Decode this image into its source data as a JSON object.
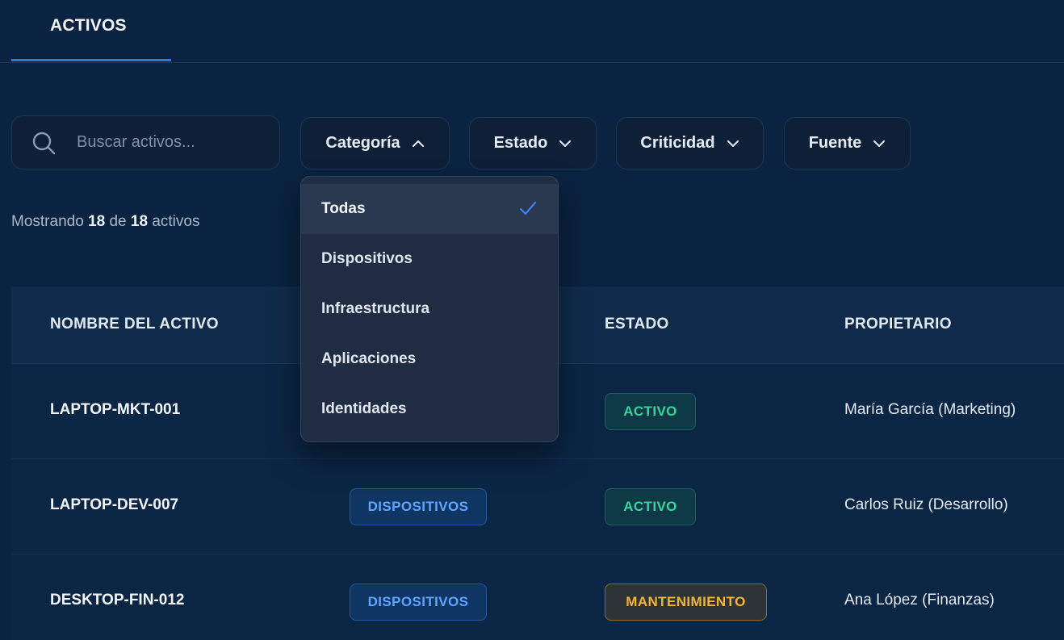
{
  "tabs": [
    {
      "label": "ACTIVOS"
    }
  ],
  "search": {
    "placeholder": "Buscar activos...",
    "value": ""
  },
  "filters": [
    {
      "label": "Categoría",
      "expanded": true
    },
    {
      "label": "Estado",
      "expanded": false
    },
    {
      "label": "Criticidad",
      "expanded": false
    },
    {
      "label": "Fuente",
      "expanded": false
    }
  ],
  "dropdown": {
    "options": [
      "Todas",
      "Dispositivos",
      "Infraestructura",
      "Aplicaciones",
      "Identidades"
    ],
    "selected": "Todas"
  },
  "count": {
    "prefix": "Mostrando",
    "shown": "18",
    "of": "de",
    "total": "18",
    "suffix": "activos"
  },
  "table": {
    "headers": [
      "NOMBRE DEL ACTIVO",
      "ESTADO",
      "PROPIETARIO"
    ],
    "rows": [
      {
        "name": "LAPTOP-MKT-001",
        "category": "",
        "status": "ACTIVO",
        "owner": "María García (Marketing)"
      },
      {
        "name": "LAPTOP-DEV-007",
        "category": "DISPOSITIVOS",
        "status": "ACTIVO",
        "owner": "Carlos Ruiz (Desarrollo)"
      },
      {
        "name": "DESKTOP-FIN-012",
        "category": "DISPOSITIVOS",
        "status": "MANTENIMIENTO",
        "owner": "Ana López (Finanzas)"
      }
    ]
  },
  "colors": {
    "background": "#0a2340",
    "accent": "#2c7be5",
    "status_active": "#37d4a0",
    "status_maintenance": "#f2b630",
    "category_badge": "#5fa4ff"
  }
}
